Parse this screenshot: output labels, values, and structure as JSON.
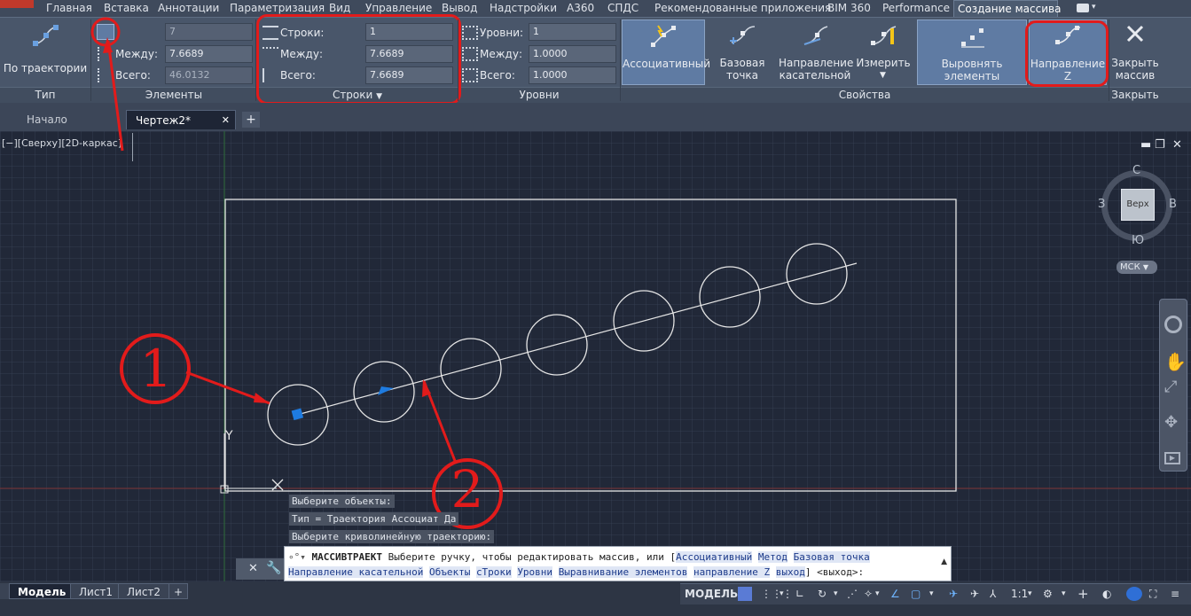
{
  "menu": {
    "tabs": [
      "Главная",
      "Вставка",
      "Аннотации",
      "Параметризация",
      "Вид",
      "Управление",
      "Вывод",
      "Надстройки",
      "A360",
      "СПДС",
      "Рекомендованные приложения",
      "BIM 360",
      "Performance",
      "Создание массива"
    ]
  },
  "ribbon": {
    "type_panel": {
      "button": "По траектории",
      "label": "Тип"
    },
    "elements_panel": {
      "label": "Элементы",
      "count": "7",
      "between_label": "Между:",
      "between_value": "7.6689",
      "total_label": "Всего:",
      "total_value": "46.0132"
    },
    "rows_panel": {
      "label": "Строки",
      "rows_label": "Строки:",
      "rows_value": "1",
      "between_label": "Между:",
      "between_value": "7.6689",
      "total_label": "Всего:",
      "total_value": "7.6689"
    },
    "levels_panel": {
      "label": "Уровни",
      "levels_label": "Уровни:",
      "levels_value": "1",
      "between_label": "Между:",
      "between_value": "1.0000",
      "total_label": "Всего:",
      "total_value": "1.0000"
    },
    "properties_panel": {
      "label": "Свойства",
      "associative": "Ассоциативный",
      "base_point": "Базовая точка",
      "tangent_1": "Направление",
      "tangent_2": "касательной",
      "measure": "Измерить",
      "align": "Выровнять элементы",
      "z_direction": "Направление Z"
    },
    "close_panel": {
      "label": "Закрыть",
      "btn_1": "Закрыть",
      "btn_2": "массив"
    }
  },
  "doc_tabs": {
    "start": "Начало",
    "drawing": "Чертеж2*"
  },
  "viewport": {
    "label": "[−][Сверху][2D-каркас]",
    "viewcube": {
      "n": "С",
      "s": "Ю",
      "w": "З",
      "e": "В",
      "top": "Верх",
      "ucs": "МСК"
    },
    "axis_x": "X",
    "axis_y": "Y"
  },
  "annotations": {
    "one": "1",
    "two": "2"
  },
  "command": {
    "history": [
      "Выберите объекты:",
      "Тип = Траектория  Ассоциат      Да",
      "Выберите криволинейную траекторию:"
    ],
    "cmd_name": "МАССИВТРАЕКТ",
    "line1_text": " Выберите ручку, чтобы редактировать массив, или [",
    "kw_assoc": "Ассоциативный",
    "kw_method": "Метод",
    "kw_base": "Базовая точка",
    "kw_tangent": "Направление касательной",
    "kw_objects": "Объекты",
    "kw_rows": "сТроки",
    "kw_levels": "Уровни",
    "kw_align": "Выравнивание элементов",
    "kw_zdir": "направление Z",
    "kw_exit": "выход",
    "line2_end": "] <выход>:"
  },
  "status": {
    "model_tab": "Модель",
    "layout1": "Лист1",
    "layout2": "Лист2",
    "model_btn": "МОДЕЛЬ",
    "scale": "1:1"
  },
  "colors": {
    "highlight_red": "#e21b1b",
    "ribbon": "#49566a",
    "viewport": "#212838",
    "accent_blue": "#5f7ba3"
  }
}
